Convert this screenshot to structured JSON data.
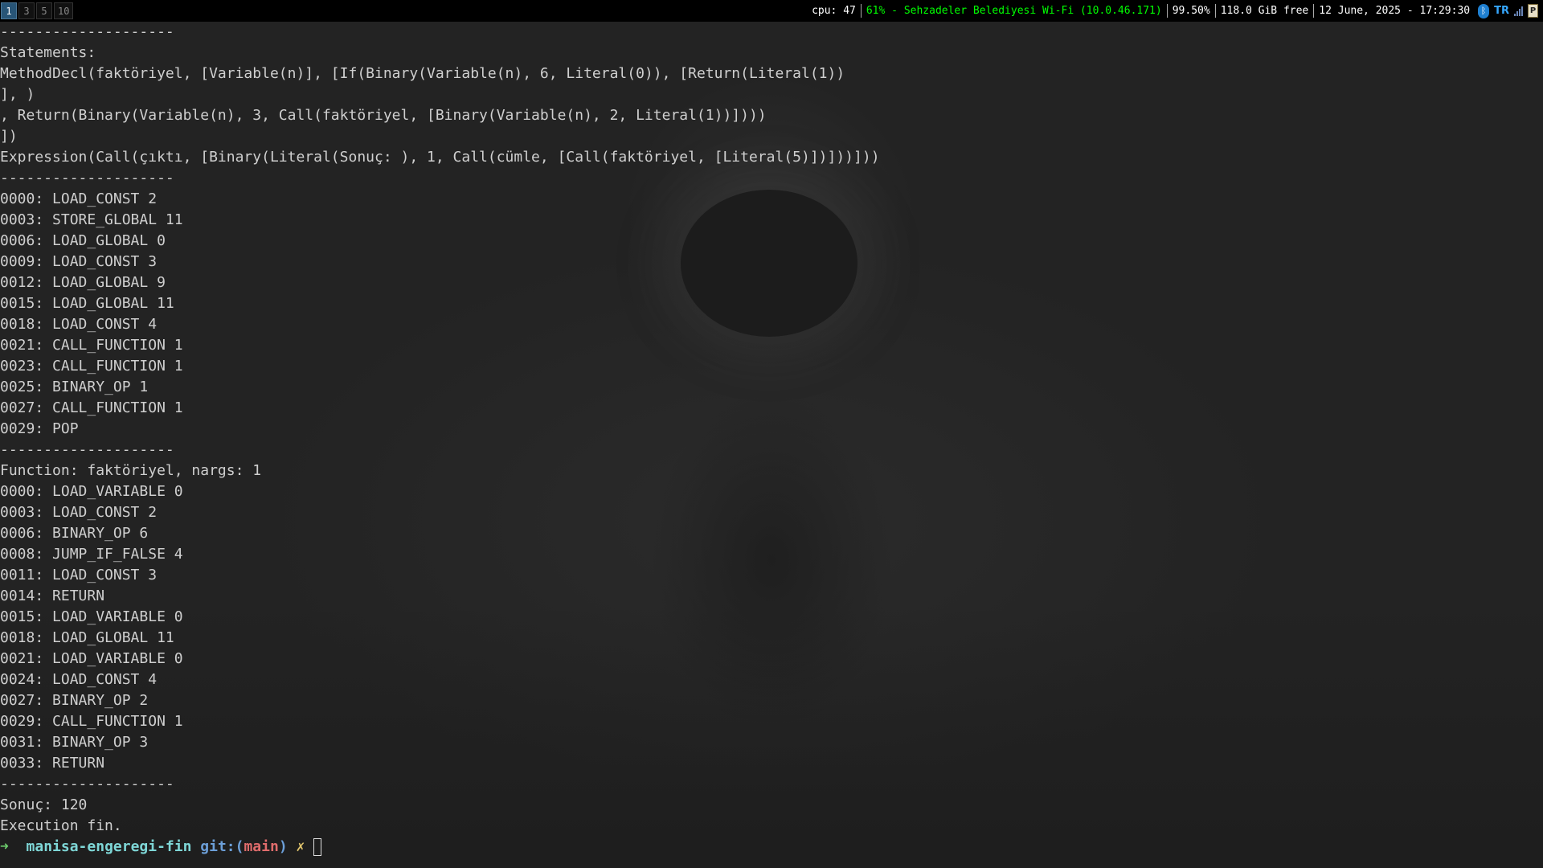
{
  "topbar": {
    "workspaces": [
      "1",
      "3",
      "5",
      "10"
    ],
    "cpu": "cpu: 47",
    "wifi": "61% - Sehzadeler Belediyesi Wi-Fi (10.0.46.171)",
    "battery": "99.50%",
    "disk": "118.0 GiB free",
    "datetime": "12 June, 2025 - 17:29:30",
    "tray": {
      "bluetooth_icon": "bluetooth-icon",
      "language": "TR",
      "signal_icon": "signal-icon",
      "clipboard_icon": "clipboard-icon",
      "clipboard_glyph": "P"
    }
  },
  "terminal": {
    "lines": [
      "--------------------",
      "Statements:",
      "MethodDecl(faktöriyel, [Variable(n)], [If(Binary(Variable(n), 6, Literal(0)), [Return(Literal(1))",
      "], )",
      ", Return(Binary(Variable(n), 3, Call(faktöriyel, [Binary(Variable(n), 2, Literal(1))])))",
      "])",
      "Expression(Call(çıktı, [Binary(Literal(Sonuç: ), 1, Call(cümle, [Call(faktöriyel, [Literal(5)])]))]))",
      "--------------------",
      "0000: LOAD_CONST 2",
      "0003: STORE_GLOBAL 11",
      "0006: LOAD_GLOBAL 0",
      "0009: LOAD_CONST 3",
      "0012: LOAD_GLOBAL 9",
      "0015: LOAD_GLOBAL 11",
      "0018: LOAD_CONST 4",
      "0021: CALL_FUNCTION 1",
      "0023: CALL_FUNCTION 1",
      "0025: BINARY_OP 1",
      "0027: CALL_FUNCTION 1",
      "0029: POP",
      "--------------------",
      "Function: faktöriyel, nargs: 1",
      "0000: LOAD_VARIABLE 0",
      "0003: LOAD_CONST 2",
      "0006: BINARY_OP 6",
      "0008: JUMP_IF_FALSE 4",
      "0011: LOAD_CONST 3",
      "0014: RETURN",
      "0015: LOAD_VARIABLE 0",
      "0018: LOAD_GLOBAL 11",
      "0021: LOAD_VARIABLE 0",
      "0024: LOAD_CONST 4",
      "0027: BINARY_OP 2",
      "0029: CALL_FUNCTION 1",
      "0031: BINARY_OP 3",
      "0033: RETURN",
      "--------------------",
      "Sonuç: 120",
      "Execution fin."
    ],
    "prompt": {
      "arrow": "➜",
      "directory": "manisa-engeregi-fin",
      "git_label": "git:(",
      "branch": "main",
      "git_close": ")",
      "dirty_marker": "✗"
    }
  }
}
